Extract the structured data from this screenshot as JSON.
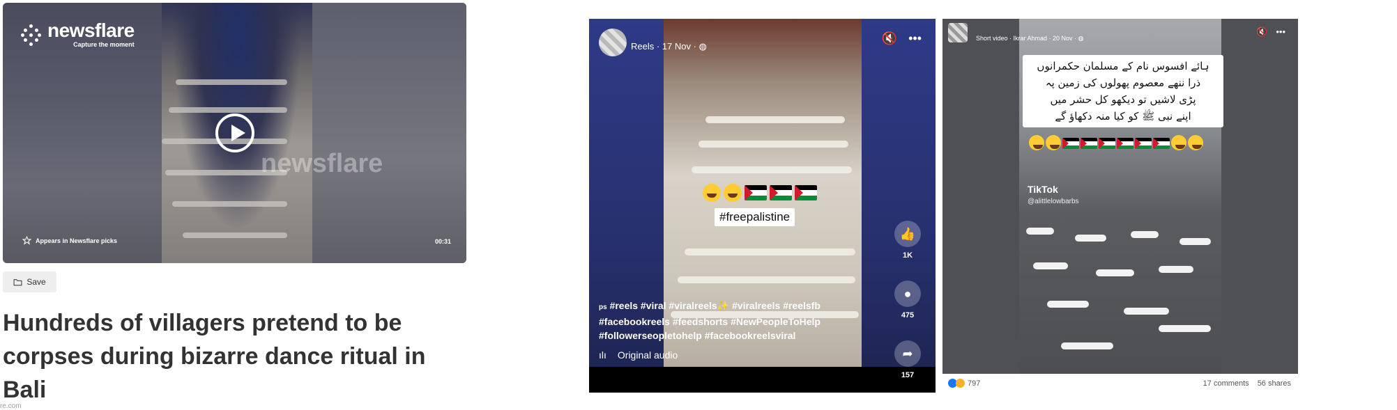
{
  "newsflare": {
    "brand": "newsflare",
    "tagline": "Capture the moment",
    "watermark": "newsflare",
    "picks_label": "Appears in Newsflare picks",
    "duration": "00:31",
    "save_label": "Save",
    "headline": "Hundreds of villagers pretend to be corpses during bizarre dance ritual in Bali",
    "source_fragment": "re.com"
  },
  "reel": {
    "meta": "Reels · 17 Nov · ",
    "hashtag_overlay": "#freepalistine",
    "likes": "1K",
    "comments": "475",
    "shares": "157",
    "caption": "#reels #viral #viralreels✨ #viralreels #reelsfb #facebookreels #feedshorts #NewPeopleToHelp #followerseopletohelp #facebookreelsviral",
    "caption_prefix": "ps",
    "audio": "Original audio"
  },
  "short": {
    "meta": "Short video · Ikrar Ahmad · 20 Nov · ",
    "urdu_lines": [
      "ہائے افسوس نام کے مسلمان حکمرانوں",
      "ذرا ننھے معصوم پھولوں کی زمین پہ",
      "پڑی لاشیں تو دیکھو کل حشر میں",
      "اپنے نبی ﷺ کو کیا منہ دکھاؤ گے"
    ],
    "tiktok": "TikTok",
    "tiktok_handle": "@alittlelowbarbs",
    "reactions_count": "797",
    "comments": "17 comments",
    "shares": "56 shares"
  },
  "colors": {
    "reel_bg": "#27306d",
    "palestine_red": "#d21a2a",
    "palestine_green": "#0b8a3a",
    "like_blue": "#1877f2"
  },
  "icons": [
    "star-icon",
    "play-icon",
    "folder-icon",
    "mute-icon",
    "more-icon",
    "like-icon",
    "comment-icon",
    "share-icon",
    "audio-icon",
    "globe-icon"
  ]
}
